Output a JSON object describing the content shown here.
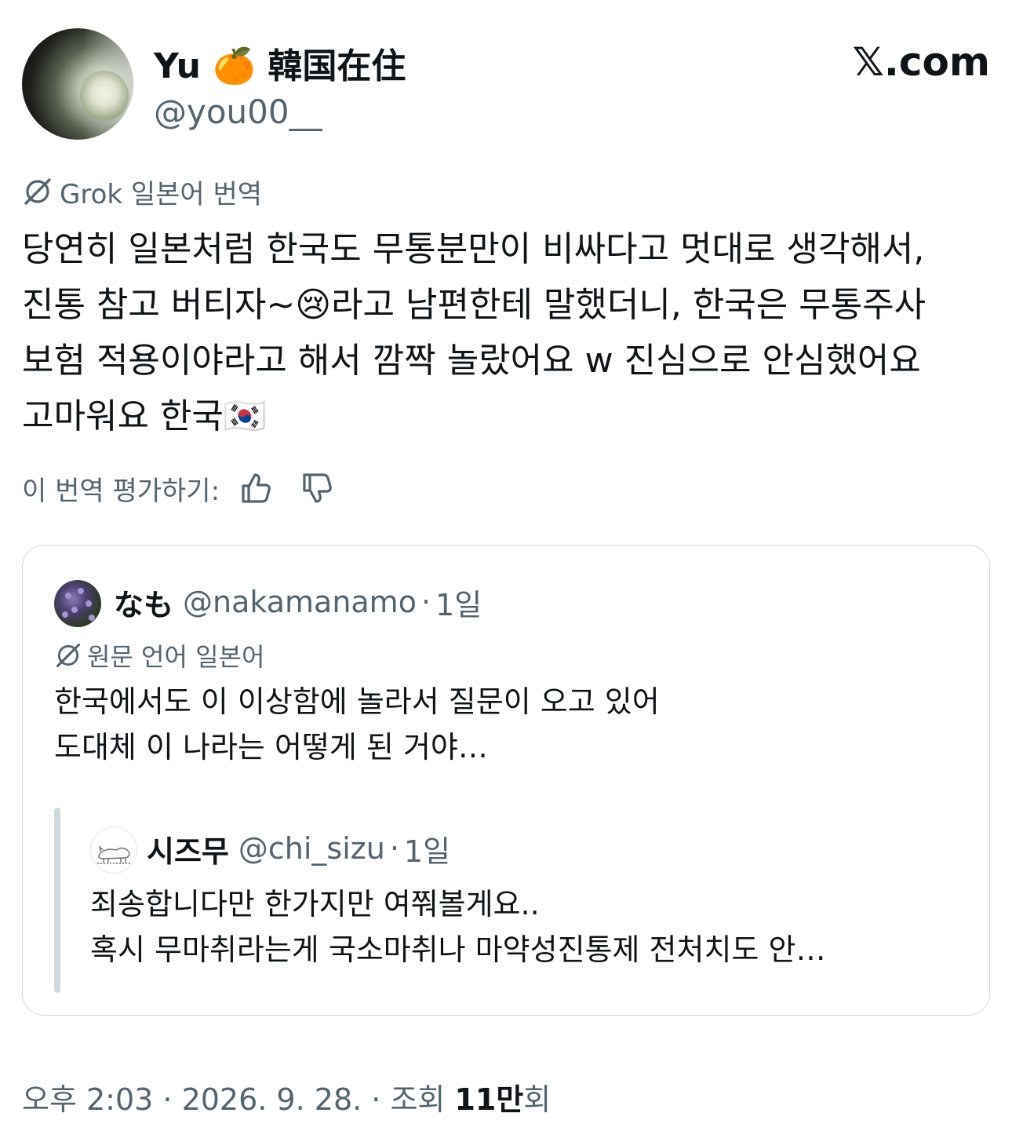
{
  "author": {
    "display_name": "Yu 🍊 韓国在住",
    "handle": "@you00__"
  },
  "site_logo": "𝕏.com",
  "translation": {
    "label": "Grok 일본어 번역"
  },
  "tweet": {
    "text": "당연히 일본처럼 한국도 무통분만이 비싸다고 멋대로 생각해서, 진통 참고 버티자~😢라고 남편한테 말했더니, 한국은 무통주사 보험 적용이야라고 해서 깜짝 놀랐어요 w 진심으로 안심했어요 고마워요 한국🇰🇷"
  },
  "rate": {
    "label": "이 번역 평가하기:"
  },
  "quote": {
    "name": "なも",
    "handle": "@nakamanamo",
    "dot": "·",
    "time": "1일",
    "lang_label": "원문 언어 일본어",
    "text": "한국에서도 이 이상함에 놀라서 질문이 오고 있어\n도대체 이 나라는 어떻게 된 거야…",
    "nested": {
      "name": "시즈무",
      "handle": "@chi_sizu",
      "dot": "·",
      "time": "1일",
      "text": "죄송합니다만 한가지만 여쭤볼게요..\n혹시 무마취라는게 국소마취나 마약성진통제 전처치도 안…"
    }
  },
  "footer": {
    "time": "오후 2:03 · 2026. 9. 28. · 조회 ",
    "views": "11만",
    "views_suffix": "회"
  },
  "icons": {
    "grok": "grok-icon",
    "translate": "translate-icon",
    "thumbs_up": "thumbs-up-icon",
    "thumbs_down": "thumbs-down-icon"
  },
  "colors": {
    "text": "#0f1419",
    "secondary": "#536471",
    "border": "#cfd9de"
  }
}
